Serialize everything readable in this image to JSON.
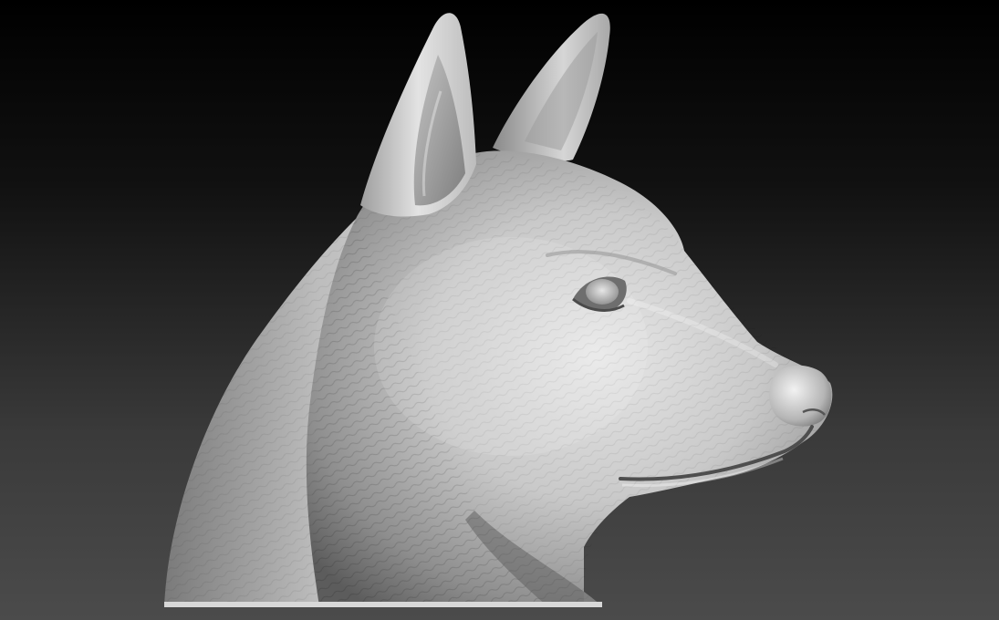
{
  "scene": {
    "subject": "dog-head-sculpt",
    "colors": {
      "background_top": "#000000",
      "background_bottom": "#4b4b4b",
      "clay_light": "#ececec",
      "clay_mid": "#b8b8b8",
      "clay_dark": "#6f6f6f",
      "clay_shadow": "#4a4a4a"
    }
  }
}
